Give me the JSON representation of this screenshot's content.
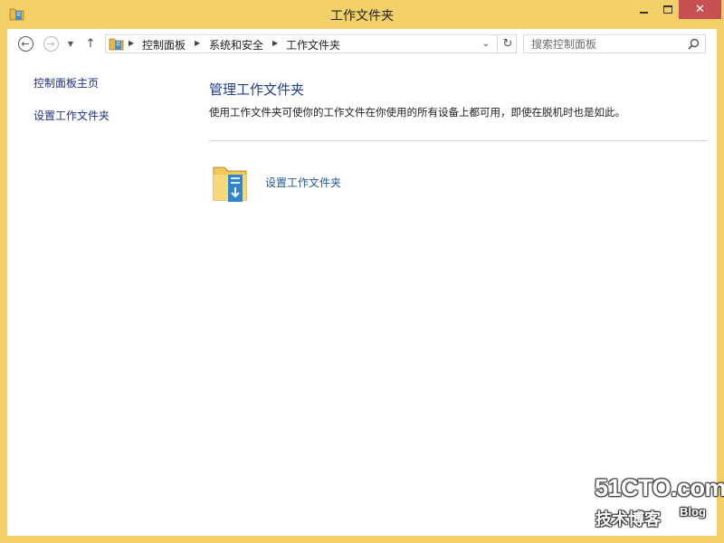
{
  "window": {
    "title": "工作文件夹",
    "icon": "work-folders-icon",
    "close_color": "#c75050",
    "frame_color": "#f4d069"
  },
  "navigation": {
    "back_icon": "back-arrow-icon",
    "forward_icon": "forward-arrow-icon",
    "recent_icon": "chevron-down-icon",
    "up_icon": "up-arrow-icon",
    "breadcrumb": [
      "控制面板",
      "系统和安全",
      "工作文件夹"
    ],
    "refresh_icon": "refresh-icon",
    "search_placeholder": "搜索控制面板"
  },
  "sidebar": {
    "items": [
      {
        "label": "控制面板主页"
      },
      {
        "label": "设置工作文件夹"
      }
    ]
  },
  "main": {
    "title": "管理工作文件夹",
    "description": "使用工作文件夹可使你的工作文件在你使用的所有设备上都可用，即使在脱机时也是如此。",
    "task_label": "设置工作文件夹",
    "link_color": "#1e5a96"
  },
  "watermark": {
    "site": "51CTO.com",
    "tagline": "技术博客",
    "blog": "Blog"
  }
}
